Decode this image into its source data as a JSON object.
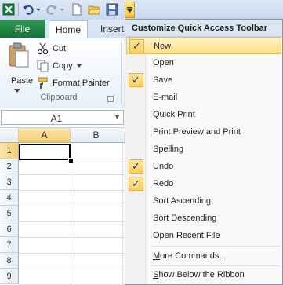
{
  "tabs": {
    "file": "File",
    "home": "Home",
    "insert": "Insert"
  },
  "clipboard": {
    "paste": "Paste",
    "cut": "Cut",
    "copy": "Copy",
    "format_painter": "Format Painter",
    "group_label": "Clipboard"
  },
  "formula_bar": {
    "name_box": "A1"
  },
  "grid": {
    "columns": [
      "A",
      "B"
    ],
    "rows": [
      "1",
      "2",
      "3",
      "4",
      "5",
      "6",
      "7",
      "8",
      "9",
      "10"
    ]
  },
  "menu": {
    "title": "Customize Quick Access Toolbar",
    "items": [
      {
        "label": "New",
        "checked": true
      },
      {
        "label": "Open",
        "checked": false
      },
      {
        "label": "Save",
        "checked": true
      },
      {
        "label": "E-mail",
        "checked": false
      },
      {
        "label": "Quick Print",
        "checked": false
      },
      {
        "label": "Print Preview and Print",
        "checked": false
      },
      {
        "label": "Spelling",
        "checked": false
      },
      {
        "label": "Undo",
        "checked": true
      },
      {
        "label": "Redo",
        "checked": true
      },
      {
        "label": "Sort Ascending",
        "checked": false
      },
      {
        "label": "Sort Descending",
        "checked": false
      },
      {
        "label": "Open Recent File",
        "checked": false
      }
    ],
    "more_commands": {
      "accel": "M",
      "rest": "ore Commands..."
    },
    "show_below": {
      "accel": "S",
      "rest": "how Below the Ribbon"
    }
  },
  "colors": {
    "file_tab": "#1e8a46",
    "highlight": "#ffe08c",
    "check": "#fbcf60"
  },
  "icons": [
    "excel-icon",
    "undo-icon",
    "redo-icon",
    "new-document-icon",
    "open-folder-icon",
    "save-icon",
    "dropdown-arrow-icon",
    "paste-icon",
    "scissors-icon",
    "copy-icon",
    "paintbrush-icon"
  ]
}
